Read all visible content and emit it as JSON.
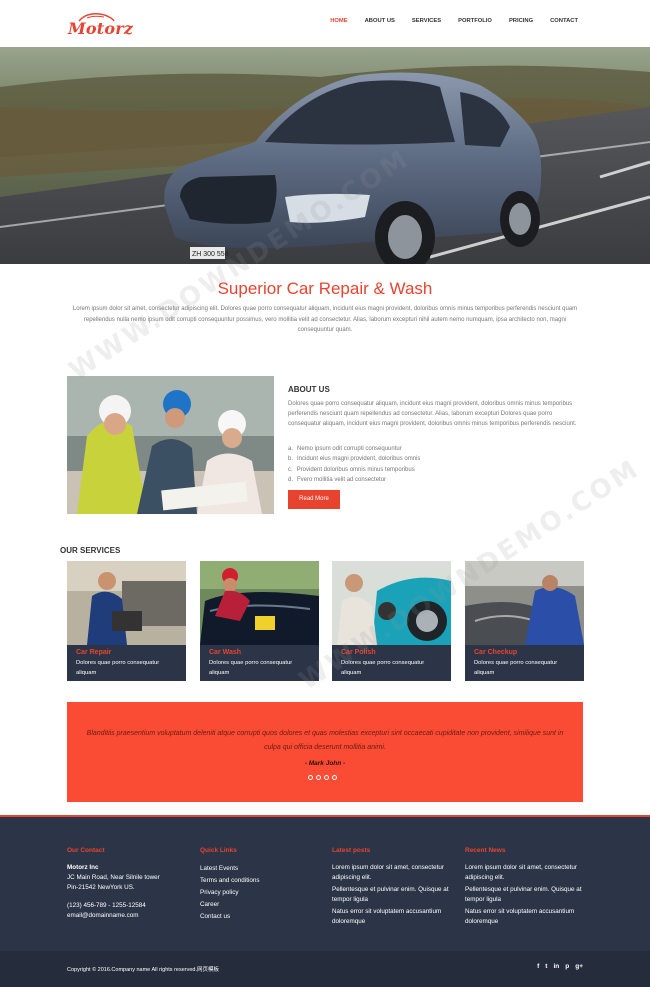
{
  "brand": {
    "logo_text": "Motorz"
  },
  "nav": {
    "items": [
      {
        "label": "HOME",
        "active": true
      },
      {
        "label": "ABOUT US",
        "active": false
      },
      {
        "label": "SERVICES",
        "active": false
      },
      {
        "label": "PORTFOLIO",
        "active": false
      },
      {
        "label": "PRICING",
        "active": false
      },
      {
        "label": "CONTACT",
        "active": false
      }
    ]
  },
  "hero": {
    "plate_text": "ZH 300 558"
  },
  "intro": {
    "title": "Superior Car Repair & Wash",
    "text": "Lorem ipsum dolor sit amet, consectetur adipiscing elit. Dolores quae porro consequatur aliquam, incidunt eius magni provident, doloribus omnis minus temporibus perferendis nesciunt quam repellendus nulla nemo ipsum odit corrupti consequuntur possimus, vero mollitia velit ad consectetur. Alias, laborum excepturi nihil autem nemo numquam, ipsa architecto non, magni consequuntur quam."
  },
  "about": {
    "title": "ABOUT US",
    "text": "Dolores quae porro consequatur aliquam, incidunt eius magni provident, doloribus omnis minus temporibus perferendis nesciunt quam repellendus ad consectetur. Alias, laborum excepturi Dolores quae porro consequatur aliquam, incidunt eius magni provident, doloribus omnis minus temporibus perferendis nesciunt.",
    "list": [
      {
        "marker": "a.",
        "text": "Nemo ipsum odit corrupti consequuntur"
      },
      {
        "marker": "b.",
        "text": "Incidunt eius magni provident, doloribus omnis"
      },
      {
        "marker": "c.",
        "text": "Provident doloribus omnis minus temporibus"
      },
      {
        "marker": "d.",
        "text": "Fvero mollitia velit ad consectetur"
      }
    ],
    "button": "Read More"
  },
  "services": {
    "title": "OUR SERVICES",
    "items": [
      {
        "name": "Car Repair",
        "desc": "Dolores quae porro consequatur aliquam"
      },
      {
        "name": "Car Wash",
        "desc": "Dolores quae porro consequatur aliquam"
      },
      {
        "name": "Car Polish",
        "desc": "Dolores quae porro consequatur aliquam"
      },
      {
        "name": "Car Checkup",
        "desc": "Dolores quae porro consequatur aliquam"
      }
    ]
  },
  "testimonial": {
    "quote": "Blanditiis praesentium voluptatum deleniti atque corrupti quos dolores et quas molestias excepturi sint occaecati cupiditate non provident, similique sunt in culpa qui officia deserunt mollitia animi.",
    "author": "- Mark John -"
  },
  "footer": {
    "contact": {
      "title": "Our Contact",
      "company": "Motorz Inc",
      "address1": "JC Main Road, Near Silnile tower",
      "address2": "Pin-21542 NewYork US.",
      "phone": "(123) 456-789 - 1255-12584",
      "email": "email@domainname.com"
    },
    "quick_links": {
      "title": "Quick Links",
      "items": [
        "Latest Events",
        "Terms and conditions",
        "Privacy policy",
        "Career",
        "Contact us"
      ]
    },
    "latest_posts": {
      "title": "Latest posts",
      "items": [
        "Lorem ipsum dolor sit amet, consectetur adipiscing elit.",
        "Pellentesque et pulvinar enim. Quisque at tempor ligula",
        "Natus error sit voluptatem accusantium doloremque"
      ]
    },
    "recent_news": {
      "title": "Recent News",
      "items": [
        "Lorem ipsum dolor sit amet, consectetur adipiscing elit.",
        "Pellentesque et pulvinar enim. Quisque at tempor ligula",
        "Natus error sit voluptatem accusantium doloremque"
      ]
    },
    "copyright": "Copyright © 2016.Company name All rights reserved.网页模板",
    "social": [
      "f",
      "t",
      "in",
      "p",
      "g+"
    ]
  },
  "watermark": "WWW.DOWNDEMO.COM",
  "colors": {
    "accent": "#e8432f",
    "testimonial_bg": "#fa4b35",
    "dark": "#2c3547",
    "darker": "#252d3d"
  }
}
